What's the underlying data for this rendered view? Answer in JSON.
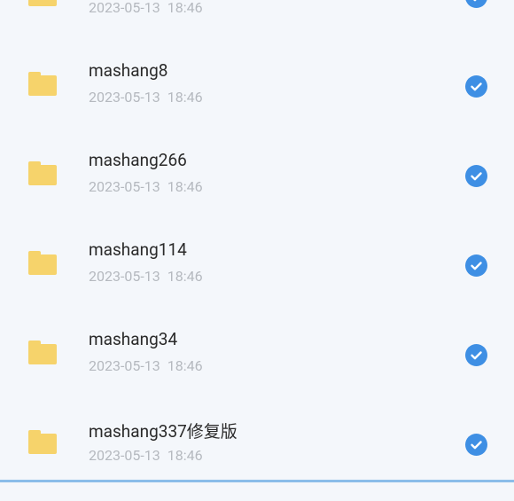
{
  "colors": {
    "folder": "#f6d36b",
    "check": "#3e8fe4",
    "accent_line": "#8bbde9"
  },
  "files": [
    {
      "name": "",
      "date": "2023-05-13  18:46",
      "selected": true,
      "icon": "folder-icon"
    },
    {
      "name": "mashang8",
      "date": "2023-05-13  18:46",
      "selected": true,
      "icon": "folder-icon"
    },
    {
      "name": "mashang266",
      "date": "2023-05-13  18:46",
      "selected": true,
      "icon": "folder-icon"
    },
    {
      "name": "mashang114",
      "date": "2023-05-13  18:46",
      "selected": true,
      "icon": "folder-icon"
    },
    {
      "name": "mashang34",
      "date": "2023-05-13  18:46",
      "selected": true,
      "icon": "folder-icon"
    },
    {
      "name": "mashang337修复版",
      "date": "2023-05-13  18:46",
      "selected": true,
      "icon": "folder-icon"
    }
  ]
}
